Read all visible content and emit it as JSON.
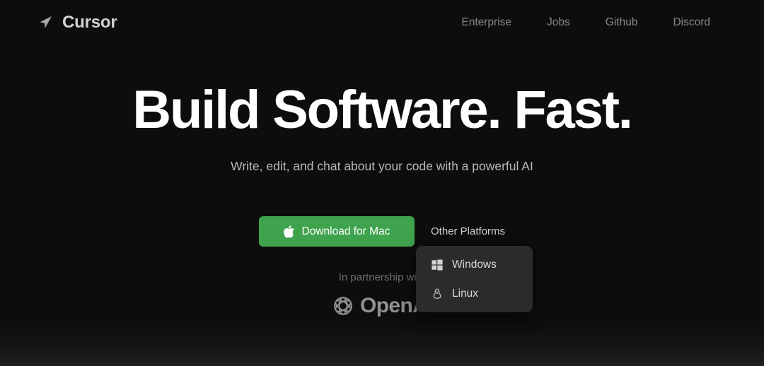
{
  "header": {
    "brand_name": "Cursor",
    "brand_icon": "cursor-arrow-icon",
    "nav": [
      {
        "label": "Enterprise"
      },
      {
        "label": "Jobs"
      },
      {
        "label": "Github"
      },
      {
        "label": "Discord"
      }
    ]
  },
  "hero": {
    "headline": "Build Software. Fast.",
    "subhead": "Write, edit, and chat about your code with a powerful AI"
  },
  "cta": {
    "download_label": "Download for Mac",
    "download_icon": "apple-icon",
    "other_platforms_label": "Other Platforms",
    "button_color": "#3fa34d"
  },
  "dropdown": {
    "items": [
      {
        "label": "Windows",
        "icon": "windows-icon"
      },
      {
        "label": "Linux",
        "icon": "linux-penguin-icon"
      }
    ]
  },
  "partnership": {
    "text": "In partnership with",
    "logo_word": "OpenAI",
    "logo_icon": "openai-knot-icon"
  },
  "colors": {
    "background": "#0d0d0d",
    "accent_green": "#3fa34d",
    "menu_surface": "#2b2b2b",
    "heading_text": "#ffffff",
    "muted_text": "#888888"
  }
}
